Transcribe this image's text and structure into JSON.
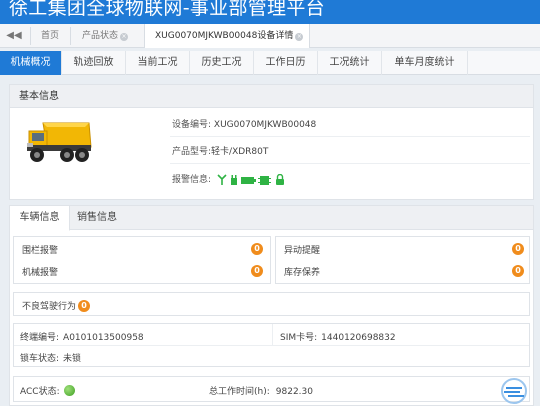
{
  "app": {
    "title": "徐工集团全球物联网-事业部管理平台"
  },
  "page_tabs": [
    {
      "label": "首页"
    },
    {
      "label": "产品状态",
      "close": "×"
    },
    {
      "label": "XUG0070MJKWB00048设备详情",
      "close": "×"
    }
  ],
  "nav": {
    "back_glyph": "◀◀"
  },
  "sub_tabs": [
    "机械概况",
    "轨迹回放",
    "当前工况",
    "历史工况",
    "工作日历",
    "工况统计",
    "单车月度统计"
  ],
  "basic_info": {
    "header": "基本信息",
    "device_no_label": "设备编号:",
    "device_no": "XUG0070MJKWB00048",
    "model_label": "产品型号:",
    "model": "轻卡/XDR80T",
    "alarm_label": "报警信息:"
  },
  "detail_tabs": [
    "车辆信息",
    "销售信息"
  ],
  "stats": {
    "fence_alarm_label": "围栏报警",
    "fence_alarm": "0",
    "mech_alarm_label": "机械报警",
    "mech_alarm": "0",
    "abnormal_move_label": "异动提醒",
    "abnormal_move": "0",
    "storage_maint_label": "库存保养",
    "storage_maint": "0",
    "bad_driving_label": "不良驾驶行为",
    "bad_driving": "0"
  },
  "vehicle": {
    "terminal_label": "终端编号:",
    "terminal": "A0101013500958",
    "sim_label": "SIM卡号:",
    "sim": "1440120698832",
    "lock_label": "锁车状态:",
    "lock": "未锁",
    "acc_label": "ACC状态:",
    "work_time_label": "总工作时间(h):",
    "work_time": "9822.30"
  },
  "colors": {
    "primary": "#1f7ad6",
    "badge": "#f08c1c",
    "icon_green": "#2fb344",
    "acc_on": "#4caf2a"
  }
}
